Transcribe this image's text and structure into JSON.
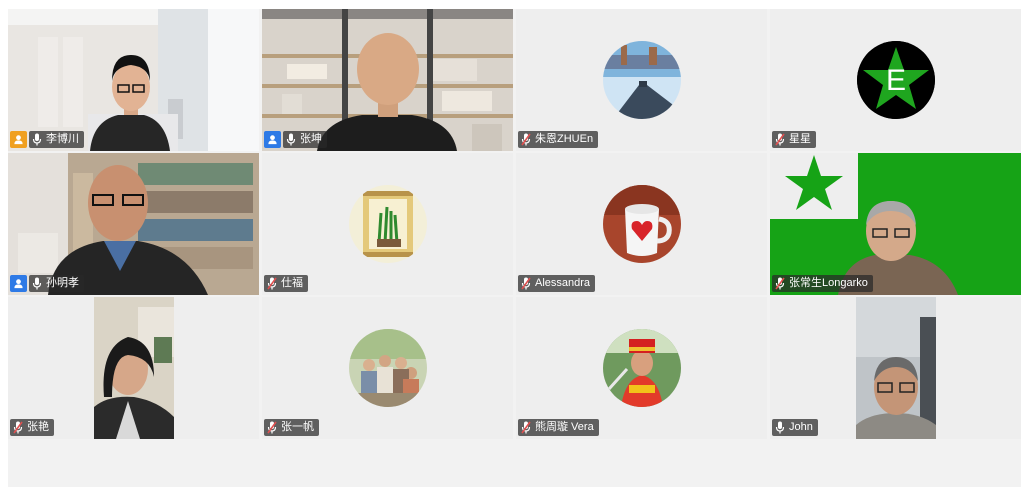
{
  "participants": [
    {
      "name": "李博川",
      "mic": "on",
      "badge": "orange",
      "view": "video-office",
      "active": true
    },
    {
      "name": "张坤",
      "mic": "on",
      "badge": "blue",
      "view": "video-shelf"
    },
    {
      "name": "朱恩ZHUEn",
      "mic": "muted",
      "view": "avatar-pier"
    },
    {
      "name": "星星",
      "mic": "muted",
      "view": "avatar-esperanto-star"
    },
    {
      "name": "孙明孝",
      "mic": "on",
      "badge": "blue",
      "view": "video-bookshelf"
    },
    {
      "name": "仕福",
      "mic": "muted",
      "view": "avatar-scroll-plant"
    },
    {
      "name": "Alessandra",
      "mic": "muted",
      "view": "avatar-mug"
    },
    {
      "name": "张常生Longarko",
      "mic": "muted",
      "view": "video-green-flag"
    },
    {
      "name": "张艳",
      "mic": "muted",
      "view": "video-woman"
    },
    {
      "name": "张一帆",
      "mic": "muted",
      "view": "avatar-group"
    },
    {
      "name": "熊周璇 Vera",
      "mic": "muted",
      "view": "avatar-costume"
    },
    {
      "name": "John",
      "mic": "on",
      "view": "video-man-glasses"
    }
  ],
  "avatar_letter": "E",
  "colors": {
    "active_border": "#3ecf7a",
    "host_badge": "#f0a020",
    "cohost_badge": "#2e7ae6",
    "muted_slash": "#e05050",
    "esperanto_green": "#1ea81e"
  }
}
